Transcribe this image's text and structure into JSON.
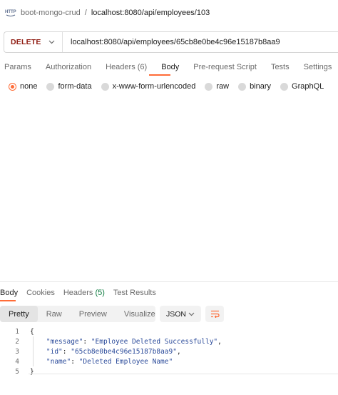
{
  "breadcrumb": {
    "icon": "http-icon",
    "collection": "boot-mongo-crud",
    "separator": "/",
    "request": "localhost:8080/api/employees/103"
  },
  "url_bar": {
    "method": "DELETE",
    "method_color": "#8e1a10",
    "url": "localhost:8080/api/employees/65cb8e0be4c96e15187b8aa9"
  },
  "request_tabs": [
    {
      "label": "Params"
    },
    {
      "label": "Authorization"
    },
    {
      "label": "Headers (6)"
    },
    {
      "label": "Body",
      "active": true
    },
    {
      "label": "Pre-request Script"
    },
    {
      "label": "Tests"
    },
    {
      "label": "Settings"
    }
  ],
  "body_options": [
    {
      "label": "none",
      "checked": true
    },
    {
      "label": "form-data"
    },
    {
      "label": "x-www-form-urlencoded"
    },
    {
      "label": "raw"
    },
    {
      "label": "binary"
    },
    {
      "label": "GraphQL"
    }
  ],
  "response_tabs": {
    "body": "Body",
    "cookies": "Cookies",
    "headers": "Headers",
    "headers_count": "(5)",
    "test_results": "Test Results"
  },
  "view_modes": [
    "Pretty",
    "Raw",
    "Preview",
    "Visualize"
  ],
  "active_view": "Pretty",
  "format": "JSON",
  "response_body": {
    "line_numbers": [
      "1",
      "2",
      "3",
      "4",
      "5"
    ],
    "open_brace": "{",
    "close_brace": "}",
    "fields": [
      {
        "key": "\"message\"",
        "value": "\"Employee Deleted Successfully\"",
        "trail": ","
      },
      {
        "key": "\"id\"",
        "value": "\"65cb8e0be4c96e15187b8aa9\"",
        "trail": ","
      },
      {
        "key": "\"name\"",
        "value": "\"Deleted Employee Name\"",
        "trail": ""
      }
    ]
  },
  "colors": {
    "accent": "#ff6c37",
    "delete_method": "#8e1a10",
    "json_string": "#2a4a9a",
    "status_count": "#0b7a3e"
  }
}
